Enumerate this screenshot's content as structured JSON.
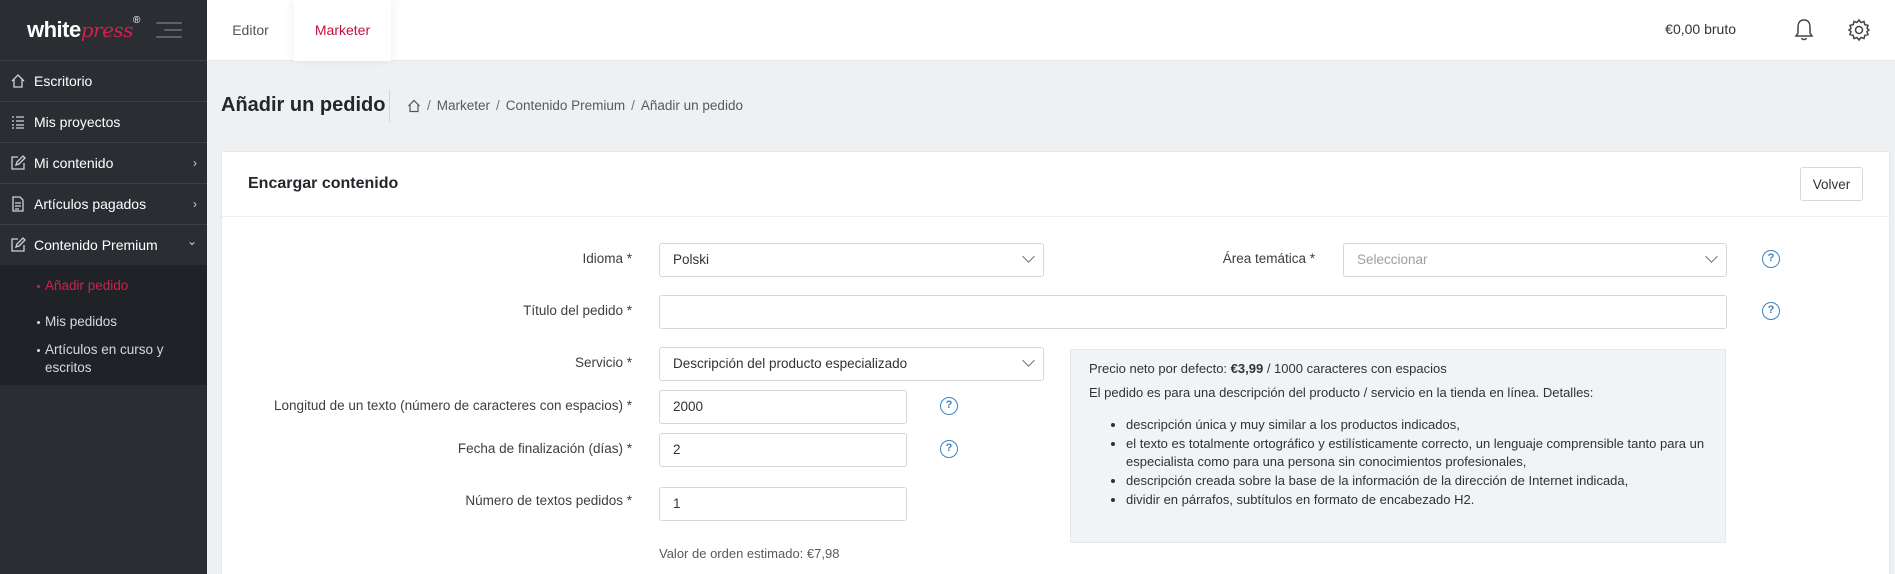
{
  "sidebar": {
    "logo_part1": "white",
    "logo_part2": "press",
    "logo_mark": "®",
    "items": [
      {
        "label": "Escritorio",
        "icon": "home-icon"
      },
      {
        "label": "Mis proyectos",
        "icon": "list-icon"
      },
      {
        "label": "Mi contenido",
        "icon": "edit-icon",
        "chevron": "›"
      },
      {
        "label": "Artículos pagados",
        "icon": "document-icon",
        "chevron": "›"
      },
      {
        "label": "Contenido Premium",
        "icon": "edit-icon",
        "chevron": "⌄"
      }
    ],
    "sub_items": [
      {
        "label": "Añadir pedido",
        "current": true
      },
      {
        "label": "Mis pedidos",
        "current": false
      },
      {
        "label": "Artículos en curso y escritos",
        "current": false
      }
    ]
  },
  "topbar": {
    "tabs": [
      "Editor",
      "Marketer"
    ],
    "active_tab": "Marketer",
    "balance": "€0,00 bruto"
  },
  "header": {
    "title": "Añadir un pedido",
    "breadcrumb": [
      "Marketer",
      "Contenido Premium",
      "Añadir un pedido"
    ]
  },
  "card": {
    "title": "Encargar contenido",
    "back_button": "Volver"
  },
  "form": {
    "idioma_label": "Idioma *",
    "idioma_value": "Polski",
    "area_label": "Área temática *",
    "area_placeholder": "Seleccionar",
    "titulo_label": "Título del pedido *",
    "titulo_value": "",
    "servicio_label": "Servicio *",
    "servicio_value": "Descripción del producto especializado",
    "longitud_label": "Longitud de un texto (número de caracteres con espacios) *",
    "longitud_value": "2000",
    "fecha_label": "Fecha de finalización (días) *",
    "fecha_value": "2",
    "numero_label": "Número de textos pedidos *",
    "numero_value": "1",
    "estimate_label": "Valor de orden estimado:",
    "estimate_value": "€7,98",
    "help_glyph": "?"
  },
  "info": {
    "price_prefix": "Precio neto por defecto:",
    "price_value": "€3,99",
    "price_suffix": "/ 1000 caracteres con espacios",
    "description": "El pedido es para una descripción del producto / servicio en la tienda en línea. Detalles:",
    "bullets": [
      "descripción única y muy similar a los productos indicados,",
      "el texto es totalmente ortográfico y estilísticamente correcto, un lenguaje comprensible tanto para un especialista como para una persona sin conocimientos profesionales,",
      "descripción creada sobre la base de la información de la dirección de Internet indicada,",
      "dividir en párrafos, subtítulos en formato de encabezado H2."
    ]
  },
  "colors": {
    "brand": "#d1214d",
    "sidebar_bg": "#2a2e33",
    "help_blue": "#3b82c4"
  }
}
